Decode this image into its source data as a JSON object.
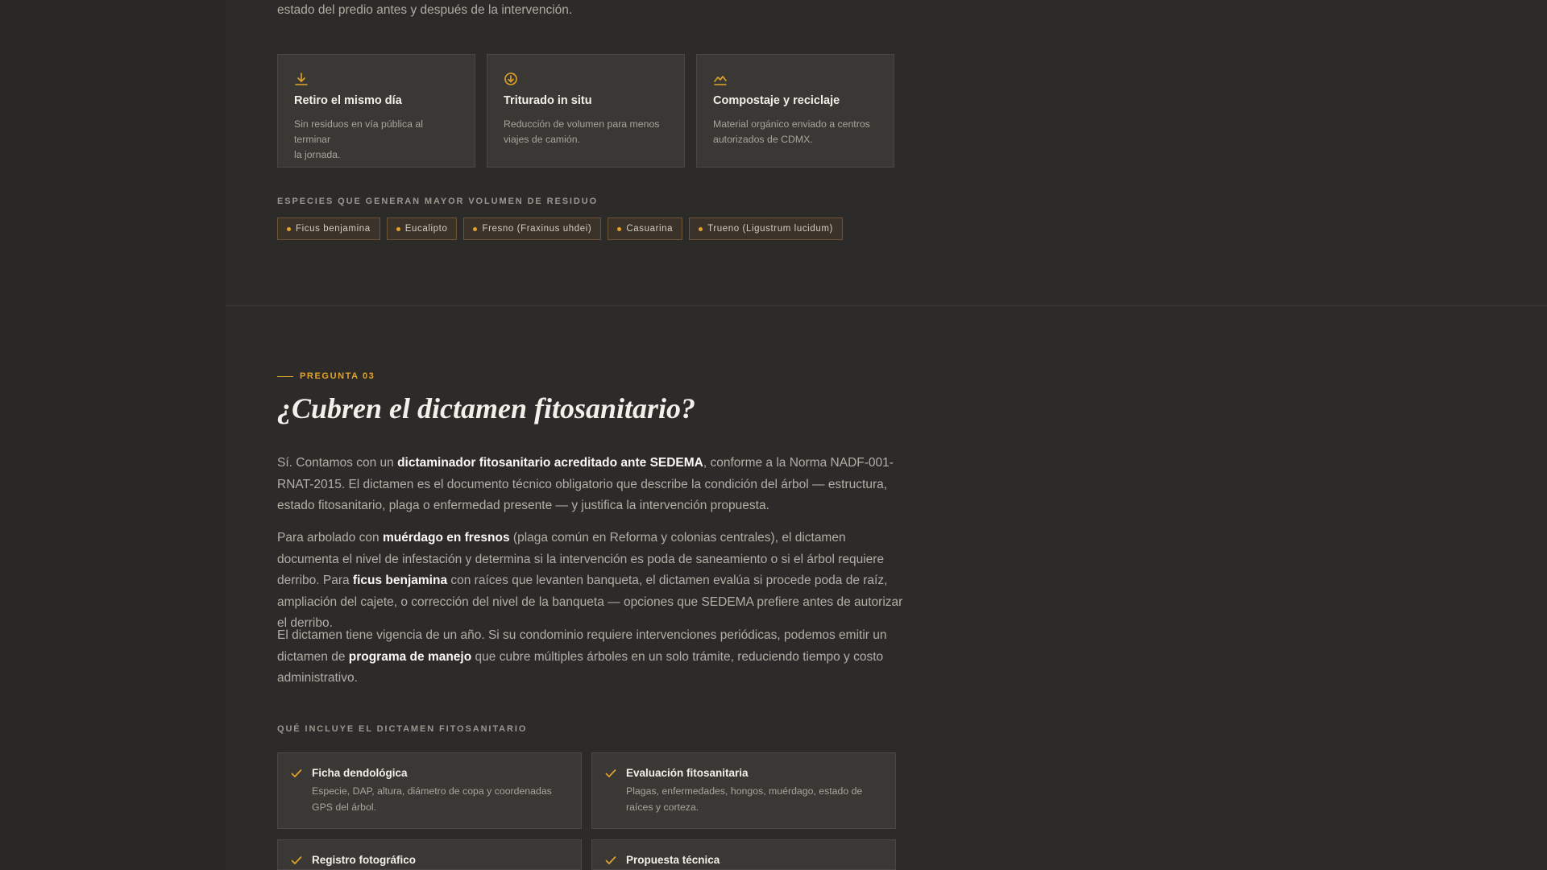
{
  "intro_tail": "estado del predio antes y después de la intervención.",
  "features": [
    {
      "icon": "download-icon",
      "title": "Retiro el mismo día",
      "desc_line1": "Sin residuos en vía pública al terminar",
      "desc_line2": "la jornada."
    },
    {
      "icon": "arrow-down-circle-icon",
      "title": "Triturado in situ",
      "desc_line1": "Reducción de volumen para menos",
      "desc_line2": "viajes de camión."
    },
    {
      "icon": "trend-chart-icon",
      "title": "Compostaje y reciclaje",
      "desc_line1": "Material orgánico enviado a centros",
      "desc_line2": "autorizados de CDMX."
    }
  ],
  "species_label": "ESPECIES QUE GENERAN MAYOR VOLUMEN DE RESIDUO",
  "species": [
    "Ficus benjamina",
    "Eucalipto",
    "Fresno (Fraxinus uhdei)",
    "Casuarina",
    "Trueno (Ligustrum lucidum)"
  ],
  "eyebrow": "PREGUNTA 03",
  "question": "¿Cubren el dictamen fitosanitario?",
  "p1": {
    "a": "Sí. Contamos con un ",
    "b": "dictaminador fitosanitario acreditado ante SEDEMA",
    "c": ", conforme a la Norma NADF-001-RNAT-2015. El dictamen es el documento técnico obligatorio que describe la condición del árbol — estructura, estado fitosanitario, plaga o enfermedad presente — y justifica la intervención propuesta."
  },
  "p2": {
    "a": "Para arbolado con ",
    "b": "muérdago en fresnos",
    "c": " (plaga común en Reforma y colonias centrales), el dictamen documenta el nivel de infestación y determina si la intervención es poda de saneamiento o si el árbol requiere derribo. Para ",
    "d": "ficus benjamina",
    "e": " con raíces que levanten banqueta, el dictamen evalúa si procede poda de raíz, ampliación del cajete, o corrección del nivel de la banqueta — opciones que SEDEMA prefiere antes de autorizar el derribo."
  },
  "p3": {
    "a": "El dictamen tiene vigencia de un año. Si su condominio requiere intervenciones periódicas, podemos emitir un dictamen de ",
    "b": "programa de manejo",
    "c": " que cubre múltiples árboles en un solo trámite, reduciendo tiempo y costo administrativo."
  },
  "includes_label": "QUÉ INCLUYE EL DICTAMEN FITOSANITARIO",
  "includes": [
    {
      "title": "Ficha dendológica",
      "desc_line1": "Especie, DAP, altura, diámetro de copa y coordenadas",
      "desc_line2": "GPS del árbol."
    },
    {
      "title": "Evaluación fitosanitaria",
      "desc_line1": "Plagas, enfermedades, hongos, muérdago, estado de",
      "desc_line2": "raíces y corteza."
    },
    {
      "title": "Registro fotográfico",
      "desc_line1": "",
      "desc_line2": ""
    },
    {
      "title": "Propuesta técnica",
      "desc_line1": "",
      "desc_line2": ""
    }
  ],
  "colors": {
    "accent": "#e3a32a",
    "background": "#2c2b29",
    "card": "#393835"
  }
}
